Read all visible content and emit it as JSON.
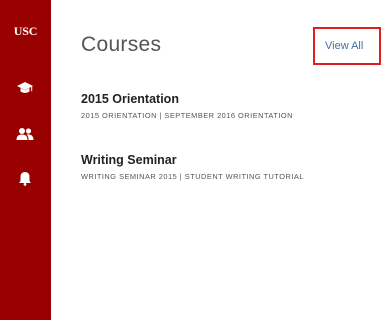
{
  "sidebar": {
    "logo_text": "USC",
    "background_color": "#990000",
    "nav_items": [
      {
        "icon": "graduation-cap-icon",
        "label": "courses"
      },
      {
        "icon": "people-icon",
        "label": "people"
      },
      {
        "icon": "bell-icon",
        "label": "notifications"
      }
    ]
  },
  "main": {
    "title": "Courses",
    "view_all_label": "View All",
    "highlight_color": "#e02020",
    "courses": [
      {
        "name": "2015 Orientation",
        "subtitle": "2015 ORIENTATION | SEPTEMBER 2016 ORIENTATION"
      },
      {
        "name": "Writing Seminar",
        "subtitle": "WRITING SEMINAR 2015 | STUDENT WRITING TUTORIAL"
      }
    ]
  }
}
